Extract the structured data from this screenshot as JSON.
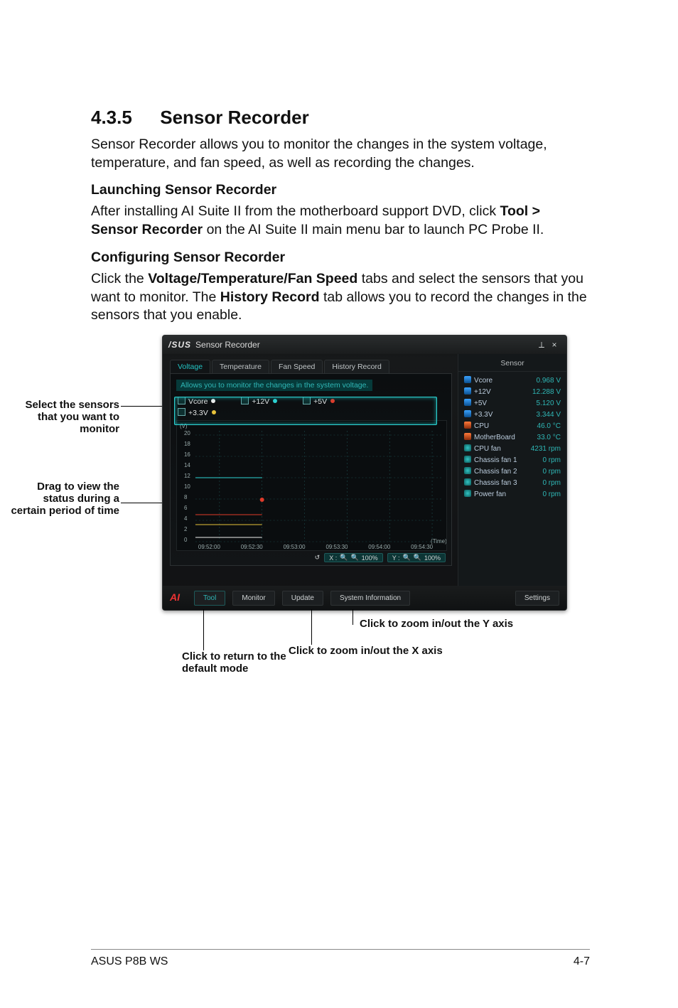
{
  "page": {
    "section_number": "4.3.5",
    "section_title": "Sensor Recorder",
    "intro": "Sensor Recorder allows you to monitor the changes in the system voltage, temperature, and fan speed, as well as recording the changes.",
    "launch_h": "Launching Sensor Recorder",
    "launch_p_pre": "After installing AI Suite II from the motherboard support DVD, click ",
    "launch_p_b": "Tool > Sensor Recorder",
    "launch_p_post": " on the AI Suite II main menu bar to launch PC Probe II.",
    "conf_h": "Configuring Sensor Recorder",
    "conf_p_pre": "Click the ",
    "conf_p_b1": "Voltage/Temperature/Fan Speed",
    "conf_p_mid": " tabs and select the sensors that you want to monitor. The ",
    "conf_p_b2": "History Record",
    "conf_p_post": " tab allows you to record the changes in the sensors that you enable."
  },
  "left_labels": {
    "select": "Select the sensors that you want to monitor",
    "drag": "Drag to view the status during a certain period of time"
  },
  "app": {
    "brand": "/SUS",
    "title": "Sensor Recorder",
    "win": {
      "min": "_",
      "close": "×",
      "pin": "⟂"
    },
    "tabs": {
      "voltage": "Voltage",
      "temperature": "Temperature",
      "fan": "Fan Speed",
      "history": "History Record"
    },
    "hint": "Allows you to monitor the changes in the system voltage.",
    "checks": {
      "vcore": "Vcore",
      "p12": "+12V",
      "p5": "+5V",
      "p33": "+3.3V"
    },
    "y_unit": "(V)",
    "y_ticks": [
      "20",
      "18",
      "16",
      "14",
      "12",
      "10",
      "8",
      "6",
      "4",
      "2",
      "0"
    ],
    "x_ticks": [
      "09:52:00",
      "09:52:30",
      "09:53:00",
      "09:53:30",
      "09:54:00",
      "09:54:30"
    ],
    "x_label": "(Time)",
    "reset_icon": "↺",
    "xzoom_label": "X :",
    "yzoom_label": "Y :",
    "xzoom_pct": "100%",
    "yzoom_pct": "100%",
    "sensor_header": "Sensor",
    "sensors": [
      {
        "icon": "bolt",
        "name": "Vcore",
        "value": "0.968",
        "unit": "V"
      },
      {
        "icon": "bolt",
        "name": "+12V",
        "value": "12.288",
        "unit": "V"
      },
      {
        "icon": "bolt",
        "name": "+5V",
        "value": "5.120",
        "unit": "V"
      },
      {
        "icon": "bolt",
        "name": "+3.3V",
        "value": "3.344",
        "unit": "V"
      },
      {
        "icon": "th",
        "name": "CPU",
        "value": "46.0",
        "unit": "°C"
      },
      {
        "icon": "th",
        "name": "MotherBoard",
        "value": "33.0",
        "unit": "°C"
      },
      {
        "icon": "fan",
        "name": "CPU fan",
        "value": "4231",
        "unit": "rpm"
      },
      {
        "icon": "fan",
        "name": "Chassis fan 1",
        "value": "0",
        "unit": "rpm"
      },
      {
        "icon": "fan",
        "name": "Chassis fan 2",
        "value": "0",
        "unit": "rpm"
      },
      {
        "icon": "fan",
        "name": "Chassis fan 3",
        "value": "0",
        "unit": "rpm"
      },
      {
        "icon": "fan",
        "name": "Power fan",
        "value": "0",
        "unit": "rpm"
      }
    ],
    "bottom": {
      "ai": "AI",
      "tool": "Tool",
      "monitor": "Monitor",
      "update": "Update",
      "sys": "System Information",
      "settings": "Settings"
    }
  },
  "callouts": {
    "zoom_y": "Click to zoom in/out the Y axis",
    "zoom_x": "Click to zoom in/out the X axis",
    "return": "Click to return to the default mode"
  },
  "footer": {
    "left": "ASUS P8B WS",
    "right": "4-7"
  }
}
